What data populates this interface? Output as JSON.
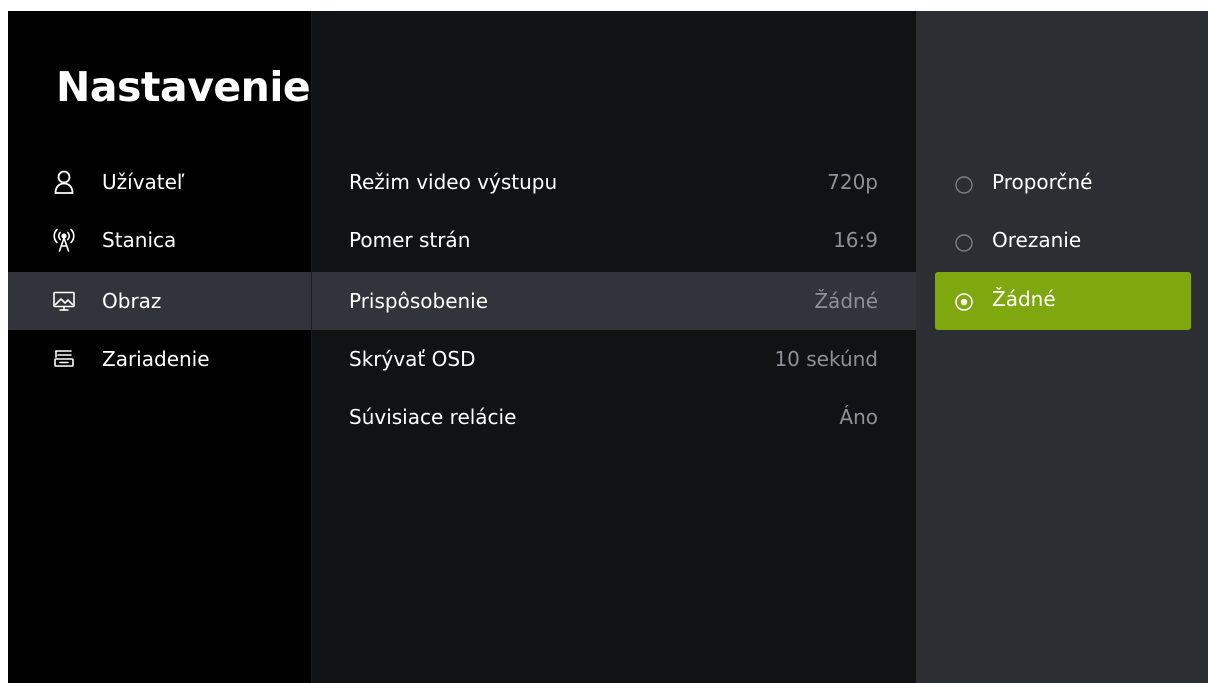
{
  "sidebar": {
    "title": "Nastavenie",
    "items": [
      {
        "label": "Užívateľ",
        "icon": "user-icon"
      },
      {
        "label": "Stanica",
        "icon": "antenna-icon"
      },
      {
        "label": "Obraz",
        "icon": "picture-icon",
        "active": true
      },
      {
        "label": "Zariadenie",
        "icon": "device-icon"
      }
    ]
  },
  "main": {
    "rows": [
      {
        "label": "Režim video výstupu",
        "value": "720p"
      },
      {
        "label": "Pomer strán",
        "value": "16:9"
      },
      {
        "label": "Prispôsobenie",
        "value": "Žádné",
        "active": true
      },
      {
        "label": "Skrývať OSD",
        "value": "10 sekúnd"
      },
      {
        "label": "Súvisiace relácie",
        "value": "Áno"
      }
    ]
  },
  "options": {
    "items": [
      {
        "label": "Proporčné",
        "selected": false
      },
      {
        "label": "Orezanie",
        "selected": false
      },
      {
        "label": "Žádné",
        "selected": true
      }
    ]
  },
  "colors": {
    "accent": "#7fa80f",
    "highlight_row": "#31343a",
    "value_text": "#8d9096",
    "options_panel": "#2b2e33"
  }
}
